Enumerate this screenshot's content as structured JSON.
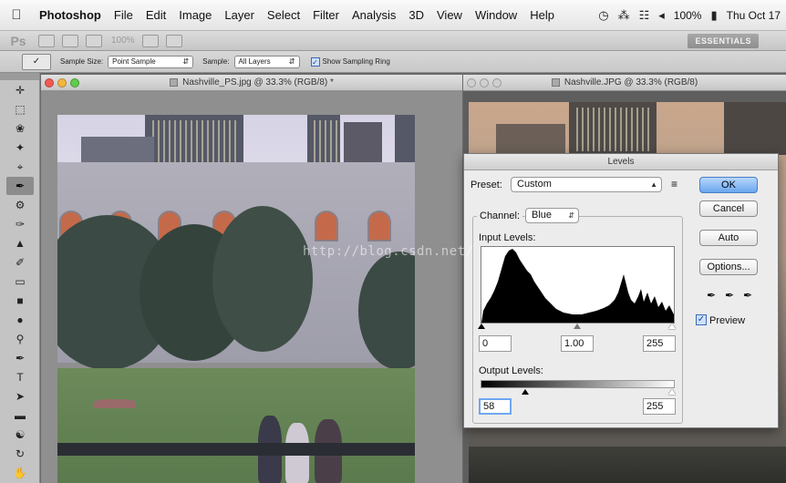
{
  "menubar": {
    "apple_icon": "apple-icon",
    "items": [
      "Photoshop",
      "File",
      "Edit",
      "Image",
      "Layer",
      "Select",
      "Filter",
      "Analysis",
      "3D",
      "View",
      "Window",
      "Help"
    ],
    "status": {
      "battery": "100%",
      "clock": "Thu Oct 17"
    }
  },
  "appbar": {
    "ps_logo": "Ps",
    "zoom": "100%",
    "workspace": "ESSENTIALS"
  },
  "options": {
    "sample_size_label": "Sample Size:",
    "sample_size_value": "Point Sample",
    "sample_label": "Sample:",
    "sample_value": "All Layers",
    "show_ring_label": "Show Sampling Ring",
    "show_ring_checked": true
  },
  "tools": [
    "move",
    "marquee",
    "lasso",
    "quick-select",
    "crop",
    "eyedropper",
    "spot-heal",
    "brush",
    "stamp",
    "history-brush",
    "eraser",
    "gradient",
    "blur",
    "dodge",
    "pen",
    "type",
    "path-select",
    "shape",
    "3d-rotate",
    "3d-orbit",
    "hand"
  ],
  "doc_left": {
    "title": "Nashville_PS.jpg @ 33.3% (RGB/8) *"
  },
  "doc_right": {
    "title": "Nashville.JPG @ 33.3% (RGB/8)"
  },
  "levels": {
    "title": "Levels",
    "preset_label": "Preset:",
    "preset_value": "Custom",
    "channel_label": "Channel:",
    "channel_value": "Blue",
    "input_levels_label": "Input Levels:",
    "input_black": "0",
    "input_gamma": "1.00",
    "input_white": "255",
    "output_levels_label": "Output Levels:",
    "output_black": "58",
    "output_white": "255",
    "buttons": {
      "ok": "OK",
      "cancel": "Cancel",
      "auto": "Auto",
      "options": "Options..."
    },
    "preview_label": "Preview",
    "preview_checked": true
  },
  "watermark": "http://blog.csdn.net/"
}
